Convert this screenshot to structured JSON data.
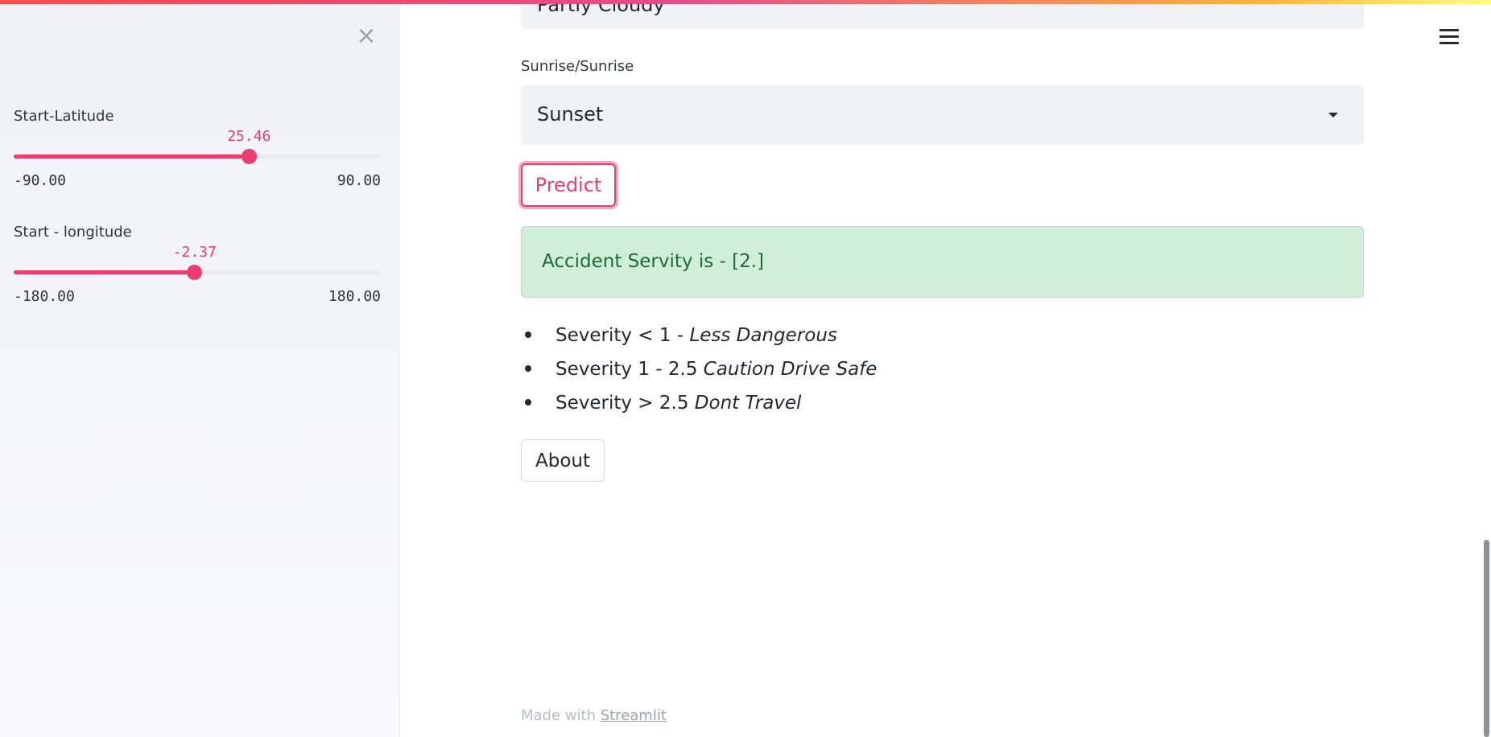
{
  "sidebar": {
    "close_icon": "×",
    "sliders": [
      {
        "label": "Start-Latitude",
        "value": "25.46",
        "min": "-90.00",
        "max": "90.00",
        "fraction": 0.641
      },
      {
        "label": "Start - longitude",
        "value": "-2.37",
        "min": "-180.00",
        "max": "180.00",
        "fraction": 0.493
      }
    ]
  },
  "main": {
    "top_select_value": "Partly Cloudy",
    "sunrise_label": "Sunrise/Sunrise",
    "sunrise_value": "Sunset",
    "predict_label": "Predict",
    "result_text": "Accident Servity is - [2.]",
    "severity_list": [
      {
        "plain": "Severity < 1 - ",
        "italic": "Less Dangerous"
      },
      {
        "plain": "Severity 1 - 2.5 ",
        "italic": "Caution Drive Safe"
      },
      {
        "plain": "Severity > 2.5 ",
        "italic": "Dont Travel"
      }
    ],
    "about_label": "About"
  },
  "footer": {
    "prefix": "Made with ",
    "link": "Streamlit"
  },
  "icons": {
    "close": "close-icon",
    "menu": "hamburger-menu-icon",
    "dropdown": "chevron-down-icon"
  },
  "colors": {
    "accent": "#ee3b70",
    "success_bg": "#d0eed8",
    "success_text": "#1a6e34"
  }
}
